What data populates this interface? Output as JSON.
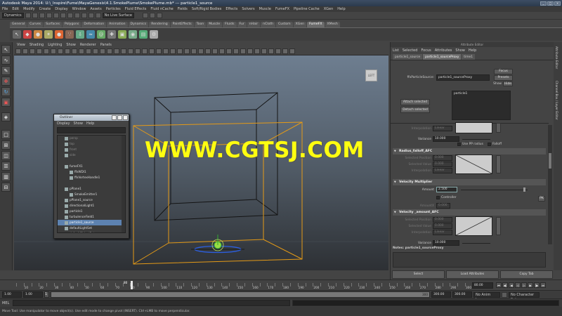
{
  "window": {
    "title": "Autodesk Maya 2014: U:\\_Inspire\\Fume\\MayaGenesis\\4.1.SmokePlume\\SmokePlume.mb* --- particle1_source",
    "controls": [
      "_",
      "□",
      "×"
    ]
  },
  "menubar": [
    "File",
    "Edit",
    "Modify",
    "Create",
    "Display",
    "Window",
    "Assets",
    "Particles",
    "Fluid Effects",
    "Fluid nCache",
    "Fields",
    "Soft/Rigid Bodies",
    "Effects",
    "Solvers",
    "Muscle",
    "FumeFX",
    "Pipeline Cache",
    "XGen",
    "Help"
  ],
  "statusline": {
    "mode": "Dynamics",
    "live_surface": "No Live Surface"
  },
  "shelf": {
    "tabs": [
      "General",
      "Curves",
      "Surfaces",
      "Polygons",
      "Deformation",
      "Animation",
      "Dynamics",
      "Rendering",
      "PaintEffects",
      "Toon",
      "Muscle",
      "Fluids",
      "Fur",
      "nHair",
      "nCloth",
      "Custom",
      "XGen",
      "FumeFX",
      "XMesh"
    ],
    "active_tab": "FumeFX"
  },
  "viewport": {
    "menu": [
      "View",
      "Shading",
      "Lighting",
      "Show",
      "Renderer",
      "Panels"
    ],
    "viewcube_label": "LEFT",
    "watermark": "WWW.CGTSJ.COM"
  },
  "outliner": {
    "title": "Outliner",
    "menu": [
      "Display",
      "Show",
      "Help"
    ],
    "items": [
      {
        "label": "persp",
        "indent": 1,
        "dim": true
      },
      {
        "label": "top",
        "indent": 1,
        "dim": true
      },
      {
        "label": "front",
        "indent": 1,
        "dim": true
      },
      {
        "label": "side",
        "indent": 1,
        "dim": true
      },
      {
        "label": "",
        "indent": 0,
        "dim": false
      },
      {
        "label": "fumeFX1",
        "indent": 1,
        "dim": false
      },
      {
        "label": "ffxWDI1",
        "indent": 2,
        "dim": false
      },
      {
        "label": "ffxVortexHandle1",
        "indent": 2,
        "dim": false
      },
      {
        "label": "",
        "indent": 0,
        "dim": false
      },
      {
        "label": "pPlane1",
        "indent": 1,
        "dim": false
      },
      {
        "label": "SmokeEmitter1",
        "indent": 2,
        "dim": false
      },
      {
        "label": "pPlane1_source",
        "indent": 1,
        "dim": false
      },
      {
        "label": "directionalLight1",
        "indent": 1,
        "dim": false
      },
      {
        "label": "particle1",
        "indent": 1,
        "dim": false
      },
      {
        "label": "turbulenceField1",
        "indent": 1,
        "dim": false
      },
      {
        "label": "particle1_source",
        "indent": 1,
        "dim": false,
        "selected": true
      },
      {
        "label": "defaultLightSet",
        "indent": 1,
        "dim": false
      },
      {
        "label": "defaultObjectSet",
        "indent": 1,
        "dim": false
      }
    ]
  },
  "attribute_editor": {
    "title": "Attribute Editor",
    "menu": [
      "List",
      "Selected",
      "Focus",
      "Attributes",
      "Show",
      "Help"
    ],
    "tabs": [
      "particle1_source",
      "particle1_sourceProxy",
      "time1"
    ],
    "active_tab": "particle1_sourceProxy",
    "source_label": "ffxParticleSource:",
    "source_value": "particle1_sourceProxy",
    "focus_btn": "Focus",
    "presets_btn": "Presets",
    "show_btn": "Show",
    "hide_btn": "Hide",
    "list_item": "particle1",
    "attach_btn": "Attach selected",
    "detach_btn": "Detach selected",
    "interp1_label": "Interpolation",
    "interp1_value": "Linear",
    "variance1_label": "Variance",
    "variance1_value": "10.000",
    "falloff_label": "Falloff",
    "use_pp_label": "Use PP radius",
    "radius_falloff_hdr": "Radius_falloff_AFC",
    "sel_pos_label": "Selected Position",
    "sel_pos_value": "0.000",
    "sel_val_label": "Selected Value",
    "sel_val_value": "0.000",
    "interp2_label": "Interpolation",
    "interp2_value": "Linear",
    "velocity_hdr": "Velocity Multiplier",
    "amount_label": "Amount",
    "amount_value": "2.500",
    "controller_label": "Controller",
    "amount2_label": "AmountX",
    "amount2_value": "0.000",
    "pk_btn": "PK",
    "velocity_amount_hdr": "Velocity _amount_AFC",
    "sel_pos2_label": "Selected Position",
    "sel_pos2_value": "0.000",
    "sel_val2_label": "Selected Value",
    "sel_val2_value": "0.000",
    "interp3_label": "Interpolation",
    "interp3_value": "Linear",
    "variance2_label": "Variance",
    "variance2_value": "10.000",
    "notes_label": "Notes: particle1_sourceProxy",
    "select_btn": "Select",
    "load_btn": "Load Attributes",
    "copy_btn": "Copy Tab"
  },
  "side_tabs": [
    "Attribute Editor",
    "Channel Box / Layer Editor"
  ],
  "timeslider": {
    "ticks": [
      "5",
      "10",
      "15",
      "20",
      "25",
      "30",
      "35",
      "40",
      "45",
      "50",
      "55",
      "60",
      "65",
      "70",
      "75",
      "80",
      "85",
      "90",
      "95",
      "100",
      "105",
      "110",
      "115",
      "120",
      "125",
      "130",
      "135",
      "140",
      "145",
      "150",
      "155",
      "160",
      "165",
      "170",
      "175",
      "180",
      "185",
      "190",
      "195",
      "200",
      "205",
      "210",
      "215",
      "220",
      "225",
      "230",
      "235",
      "240",
      "245",
      "250",
      "255",
      "260",
      "265",
      "270",
      "275",
      "280",
      "285",
      "290",
      "295",
      "300"
    ],
    "current": "80",
    "current_field": "80.00"
  },
  "rangebar": {
    "start": "1.00",
    "start2": "1.00",
    "frame": "1",
    "end_inner": "300",
    "end": "300.00",
    "end2": "300.00",
    "anim_layer": "No Anim Layer",
    "char_set": "No Character Set"
  },
  "cmdline": {
    "lang": "MEL"
  },
  "helpline": "Move Tool: Use manipulator to move object(s). Use edit mode to change pivot (INSERT). Ctrl+LMB to move perpendicular."
}
